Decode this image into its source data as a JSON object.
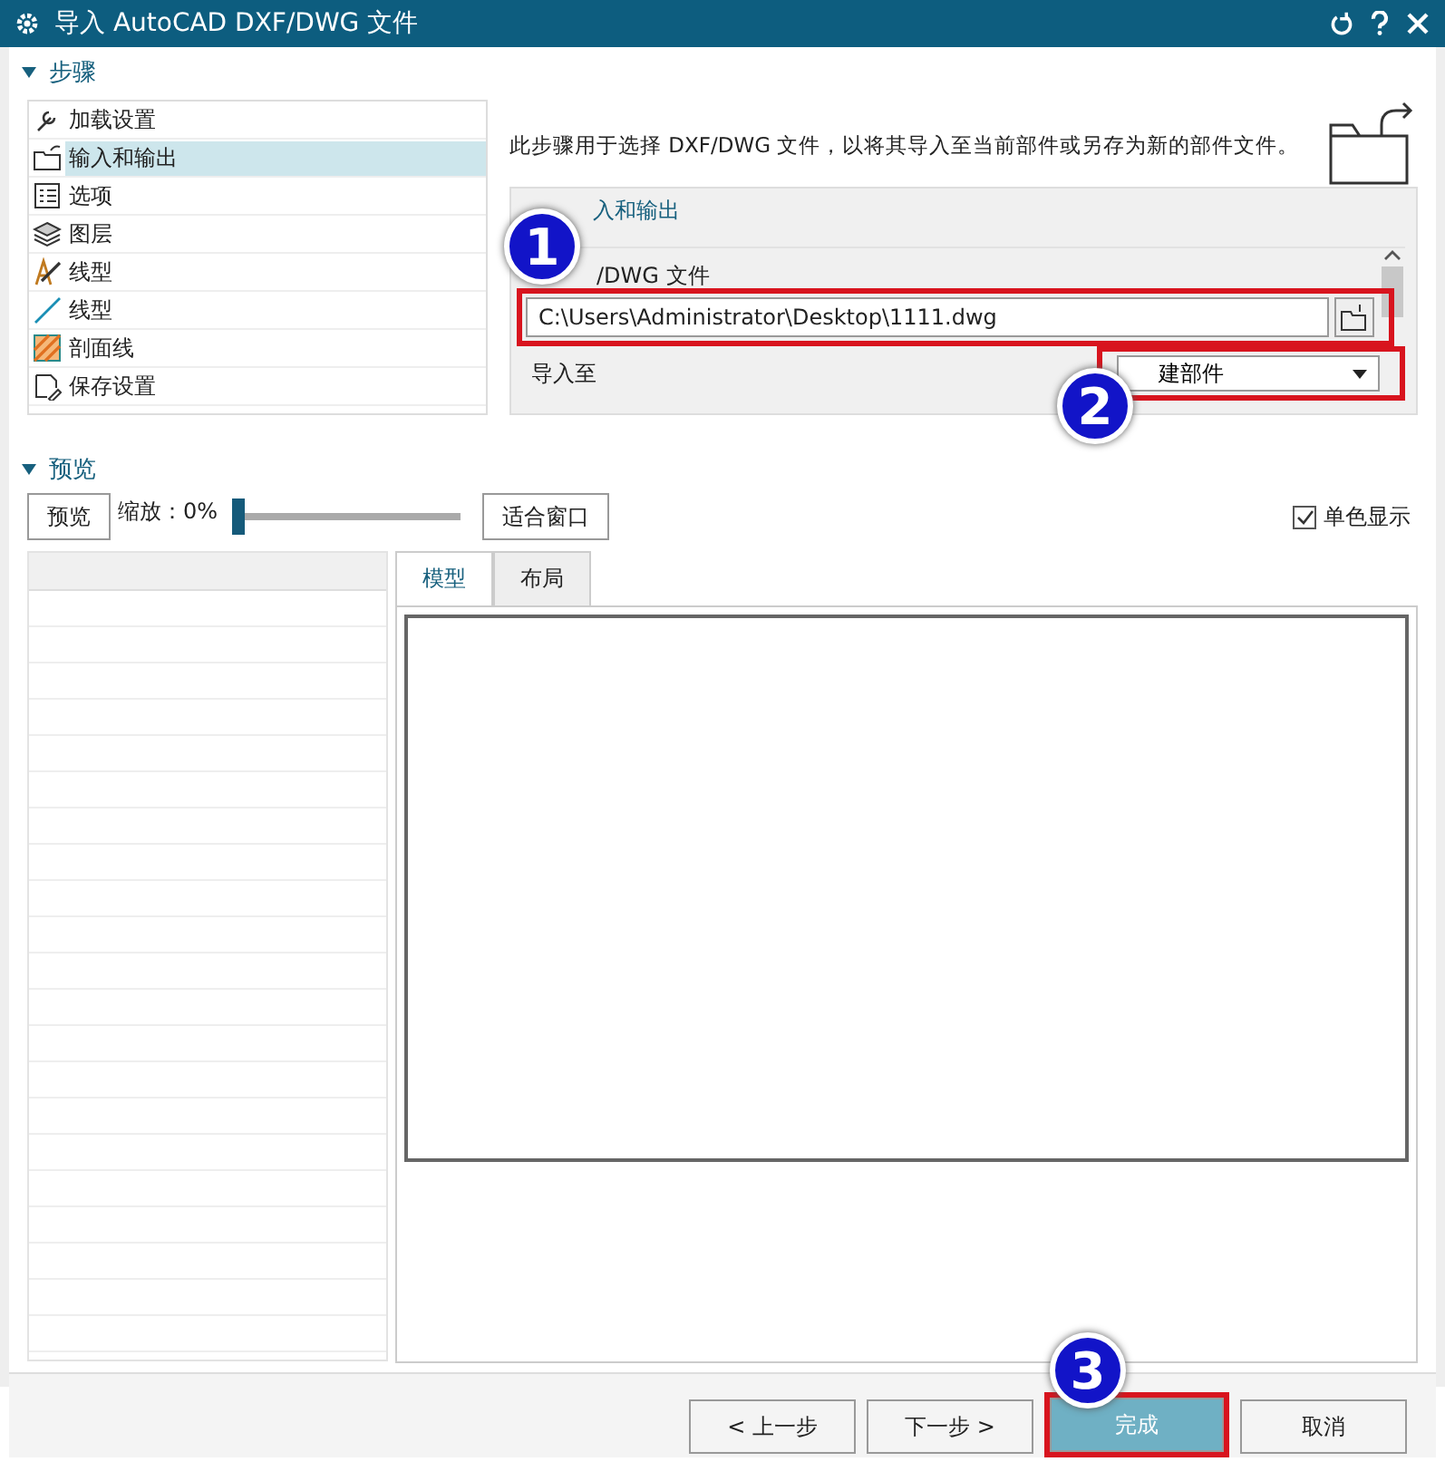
{
  "window": {
    "title": "导入 AutoCAD DXF/DWG 文件"
  },
  "steps": {
    "title": "步骤",
    "expanded": true,
    "items": [
      {
        "label": "加载设置",
        "selected": false
      },
      {
        "label": "输入和输出",
        "selected": true
      },
      {
        "label": "选项",
        "selected": false
      },
      {
        "label": "图层",
        "selected": false
      },
      {
        "label": "线型",
        "selected": false
      },
      {
        "label": "线型",
        "selected": false
      },
      {
        "label": "剖面线",
        "selected": false
      },
      {
        "label": "保存设置",
        "selected": false
      }
    ]
  },
  "description": "此步骤用于选择 DXF/DWG 文件，以将其导入至当前部件或另存为新的部件文件。",
  "io_group": {
    "title": "入和输出",
    "file_label": "/DWG 文件",
    "file_value": "C:\\Users\\Administrator\\Desktop\\1111.dwg",
    "import_label": "导入至",
    "import_value": "建部件"
  },
  "preview": {
    "title": "预览",
    "expanded": true,
    "preview_button": "预览",
    "zoom_label": "缩放：0%",
    "zoom": {
      "level": 0
    },
    "fit_button": "适合窗口",
    "mono": {
      "label": "单色显示",
      "checked": true
    },
    "tabs": [
      {
        "label": "模型",
        "selected": true
      },
      {
        "label": "布局",
        "selected": false
      }
    ]
  },
  "buttons": [
    {
      "label": "< 上一步",
      "kind": "plain"
    },
    {
      "label": "下一步 >",
      "kind": "plain"
    },
    {
      "label": "完成",
      "kind": "primary"
    },
    {
      "label": "取消",
      "kind": "plain"
    }
  ],
  "annotations": [
    "1",
    "2",
    "3"
  ]
}
